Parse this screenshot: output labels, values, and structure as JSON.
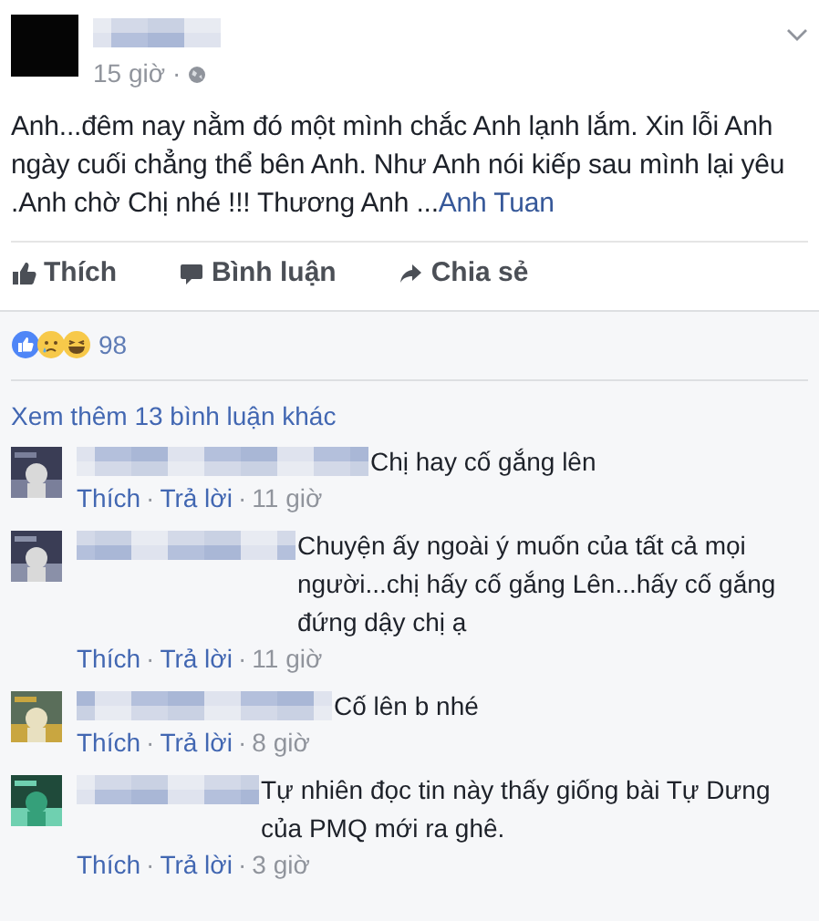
{
  "post": {
    "time": "15 giờ",
    "separator": "·",
    "text": "Anh...đêm nay nằm đó một mình chắc Anh lạnh lắm. Xin lỗi Anh ngày cuối chẳng thể bên Anh. Như Anh nói kiếp sau mình lại yêu .Anh chờ Chị nhé !!! Thương Anh ...",
    "link": "Anh Tuan"
  },
  "actions": [
    {
      "kind": "like",
      "label": "Thích"
    },
    {
      "kind": "comment",
      "label": "Bình luận"
    },
    {
      "kind": "share",
      "label": "Chia sẻ"
    }
  ],
  "reactions": {
    "icons": [
      {
        "kind": "like"
      },
      {
        "kind": "sad"
      },
      {
        "kind": "haha"
      }
    ],
    "count": "98"
  },
  "more_comments": "Xem thêm 13 bình luận khác",
  "comments": [
    {
      "text": "Chị hay cố gắng lên",
      "meta": [
        {
          "kind": "link",
          "text": "Thích"
        },
        {
          "kind": "sep",
          "text": "·"
        },
        {
          "kind": "link",
          "text": "Trả lời"
        },
        {
          "kind": "sep",
          "text": "·"
        },
        {
          "kind": "time",
          "text": "11 giờ"
        }
      ]
    },
    {
      "text": "Chuyện ấy ngoài ý muốn của tất cả mọi người...chị hấy cố gắng Lên...hấy cố gắng đứng dậy chị ạ",
      "meta": [
        {
          "kind": "link",
          "text": "Thích"
        },
        {
          "kind": "sep",
          "text": "·"
        },
        {
          "kind": "link",
          "text": "Trả lời"
        },
        {
          "kind": "sep",
          "text": "·"
        },
        {
          "kind": "time",
          "text": "11 giờ"
        }
      ]
    },
    {
      "text": "Cố lên b nhé",
      "meta": [
        {
          "kind": "link",
          "text": "Thích"
        },
        {
          "kind": "sep",
          "text": "·"
        },
        {
          "kind": "link",
          "text": "Trả lời"
        },
        {
          "kind": "sep",
          "text": "·"
        },
        {
          "kind": "time",
          "text": "8 giờ"
        }
      ]
    },
    {
      "text": "Tự nhiên đọc tin này thấy giống bài Tự Dưng của PMQ mới ra ghê.",
      "meta": [
        {
          "kind": "link",
          "text": "Thích"
        },
        {
          "kind": "sep",
          "text": "·"
        },
        {
          "kind": "link",
          "text": "Trả lời"
        },
        {
          "kind": "sep",
          "text": "·"
        },
        {
          "kind": "time",
          "text": "3 giờ"
        }
      ]
    }
  ]
}
